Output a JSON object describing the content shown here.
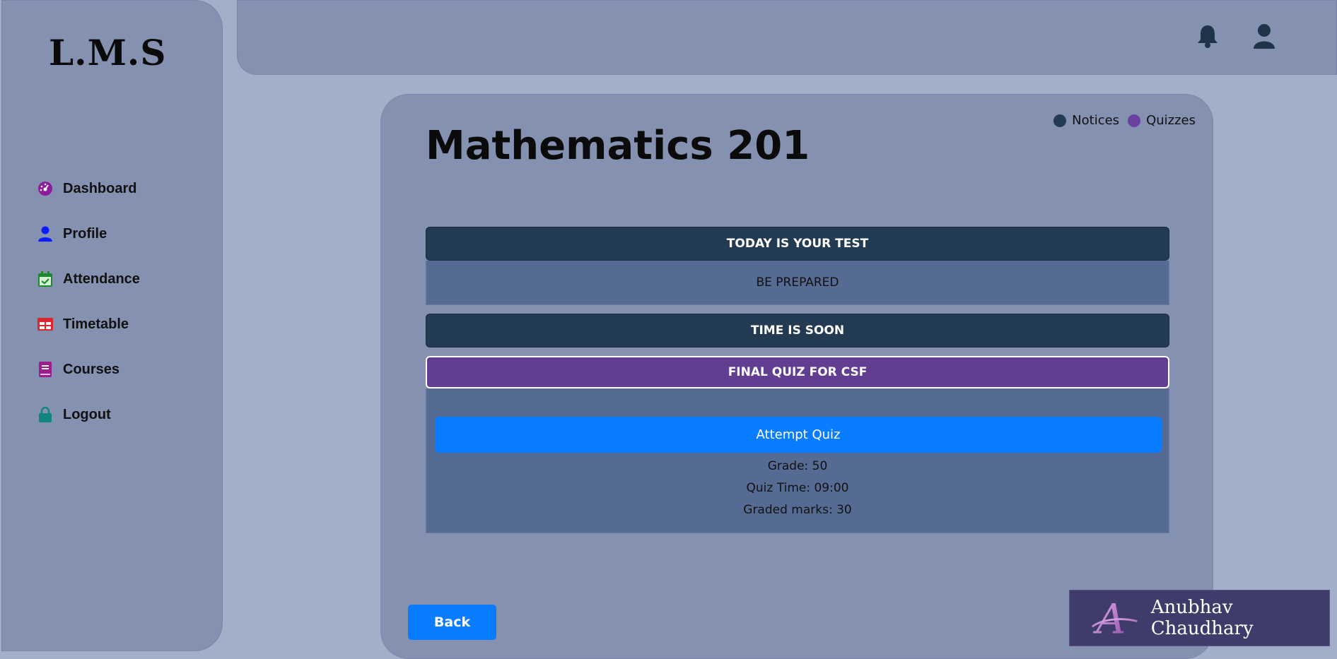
{
  "app": {
    "logo": "L.M.S"
  },
  "sidebar": {
    "items": [
      {
        "label": "Dashboard",
        "icon": "dashboard-icon",
        "color": "#8e1b9c"
      },
      {
        "label": "Profile",
        "icon": "user-icon",
        "color": "#0a1cff"
      },
      {
        "label": "Attendance",
        "icon": "calendar-check-icon",
        "color": "#1f8a2a"
      },
      {
        "label": "Timetable",
        "icon": "table-icon",
        "color": "#e0242c"
      },
      {
        "label": "Courses",
        "icon": "book-icon",
        "color": "#9b1e8c"
      },
      {
        "label": "Logout",
        "icon": "lock-icon",
        "color": "#13857f"
      }
    ]
  },
  "header": {
    "icons": [
      "bell-icon",
      "user-icon"
    ],
    "icon_color": "#1f3448"
  },
  "course": {
    "title": "Mathematics 201",
    "legend": [
      {
        "label": "Notices",
        "color": "#223a52"
      },
      {
        "label": "Quizzes",
        "color": "#6a42a0"
      }
    ],
    "notices": [
      {
        "title": "TODAY IS YOUR TEST",
        "body": "BE PREPARED"
      },
      {
        "title": "TIME IS SOON"
      }
    ],
    "quiz": {
      "title": "FINAL QUIZ FOR CSF",
      "button_label": "Attempt Quiz",
      "grade": "Grade: 50",
      "quiz_time": "Quiz Time: 09:00",
      "graded_marks": "Graded marks: 30"
    },
    "back_label": "Back"
  },
  "signature": {
    "mark": "A",
    "name": "Anubhav Chaudhary"
  }
}
